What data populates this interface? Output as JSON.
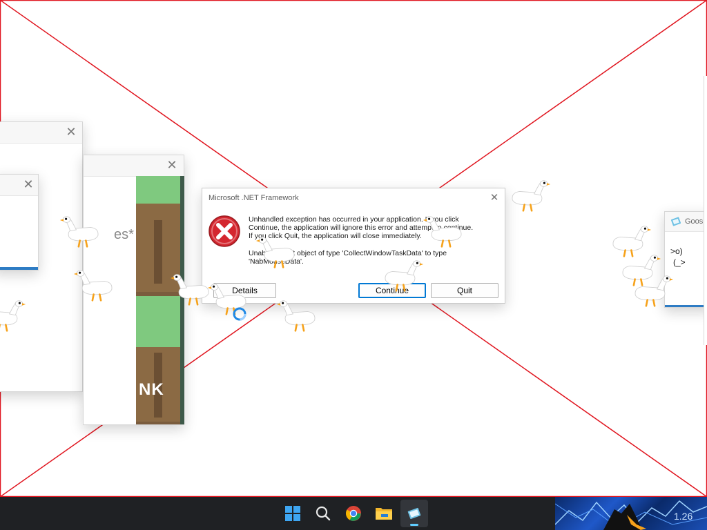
{
  "dialog": {
    "title": "Microsoft .NET Framework",
    "line1": "Unhandled exception has occurred in your application. If you click",
    "line2": "Continue, the application will ignore this error and attempt to continue.",
    "line3": "If you click Quit, the application will close immediately.",
    "line4": "Unable to cast object of type 'CollectWindowTaskData' to type",
    "line5": "'NabMouseData'.",
    "details_label": "Details",
    "continue_label": "Continue",
    "quit_label": "Quit",
    "close_glyph": "✕"
  },
  "goose_window": {
    "title": "Goos",
    "ascii_line1": ">o)",
    "ascii_line2": "(_>"
  },
  "left_window": {
    "partial_text": "es*",
    "banner_text": "NK"
  },
  "taskbar": {
    "icons": [
      "start-icon",
      "search-icon",
      "chrome-icon",
      "file-explorer-icon",
      "notepad-icon"
    ],
    "tray_clock_fragment": "1.26"
  },
  "colors": {
    "overlay_line": "#e0141e",
    "taskbar_bg": "#1f2124",
    "accent": "#0078d4",
    "error_red": "#d4272f",
    "goose_beak": "#f6a21b"
  }
}
